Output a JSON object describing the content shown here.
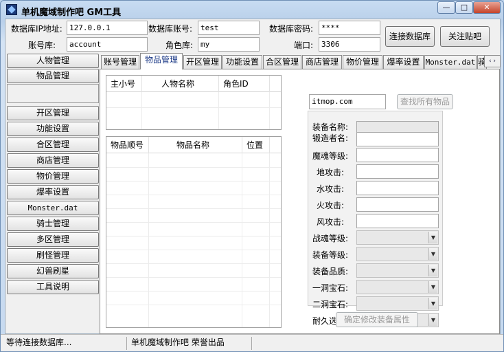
{
  "app": {
    "title": "单机魔域制作吧 GM工具",
    "controls": {
      "minimize": "—",
      "maximize": "□",
      "close": "✕"
    }
  },
  "connection": {
    "ip_label": "数据库IP地址:",
    "ip_value": "127.0.0.1",
    "account_label": "数据库账号:",
    "account_value": "test",
    "password_label": "数据库密码:",
    "password_value": "****",
    "acct_db_label": "账号库:",
    "acct_db_value": "account",
    "role_db_label": "角色库:",
    "role_db_value": "my",
    "port_label": "端口:",
    "port_value": "3306",
    "connect_button": "连接数据库",
    "close_post_button": "关注贴吧"
  },
  "sidebar": {
    "items": [
      {
        "label": "人物管理"
      },
      {
        "label": "物品管理"
      },
      {
        "label": "开区管理"
      },
      {
        "label": "功能设置"
      },
      {
        "label": "合区管理"
      },
      {
        "label": "商店管理"
      },
      {
        "label": "物价管理"
      },
      {
        "label": "爆率设置"
      },
      {
        "label": "Monster.dat"
      },
      {
        "label": "骑士管理"
      },
      {
        "label": "多区管理"
      },
      {
        "label": "刷怪管理"
      },
      {
        "label": "幻兽刷星"
      },
      {
        "label": "工具说明"
      }
    ]
  },
  "tabs": [
    {
      "label": "账号管理"
    },
    {
      "label": "物品管理",
      "active": true
    },
    {
      "label": "开区管理"
    },
    {
      "label": "功能设置"
    },
    {
      "label": "合区管理"
    },
    {
      "label": "商店管理"
    },
    {
      "label": "物价管理"
    },
    {
      "label": "爆率设置"
    },
    {
      "label": "Monster.dat"
    },
    {
      "label": "骑士"
    }
  ],
  "tab_scroll": "‹ ›",
  "items_tab": {
    "roles_grid": {
      "headers": [
        "主小号",
        "人物名称",
        "角色ID"
      ]
    },
    "items_grid": {
      "headers": [
        "物品顺号",
        "物品名称",
        "位置"
      ]
    },
    "search_value": "itmop.com",
    "find_all_button": "查找所有物品",
    "form": {
      "labels": [
        "装备名称:",
        "锻造者名:",
        "魔魂等级:",
        "地攻击:",
        "水攻击:",
        "火攻击:",
        "风攻击:",
        "战魂等级:",
        "装备等级:",
        "装备品质:",
        "一洞宝石:",
        "二洞宝石:",
        "耐久选择:"
      ],
      "confirm_button": "确定修改装备属性"
    }
  },
  "status": {
    "left": "等待连接数据库...",
    "middle": "单机魔域制作吧 荣誉出品",
    "right": ""
  }
}
